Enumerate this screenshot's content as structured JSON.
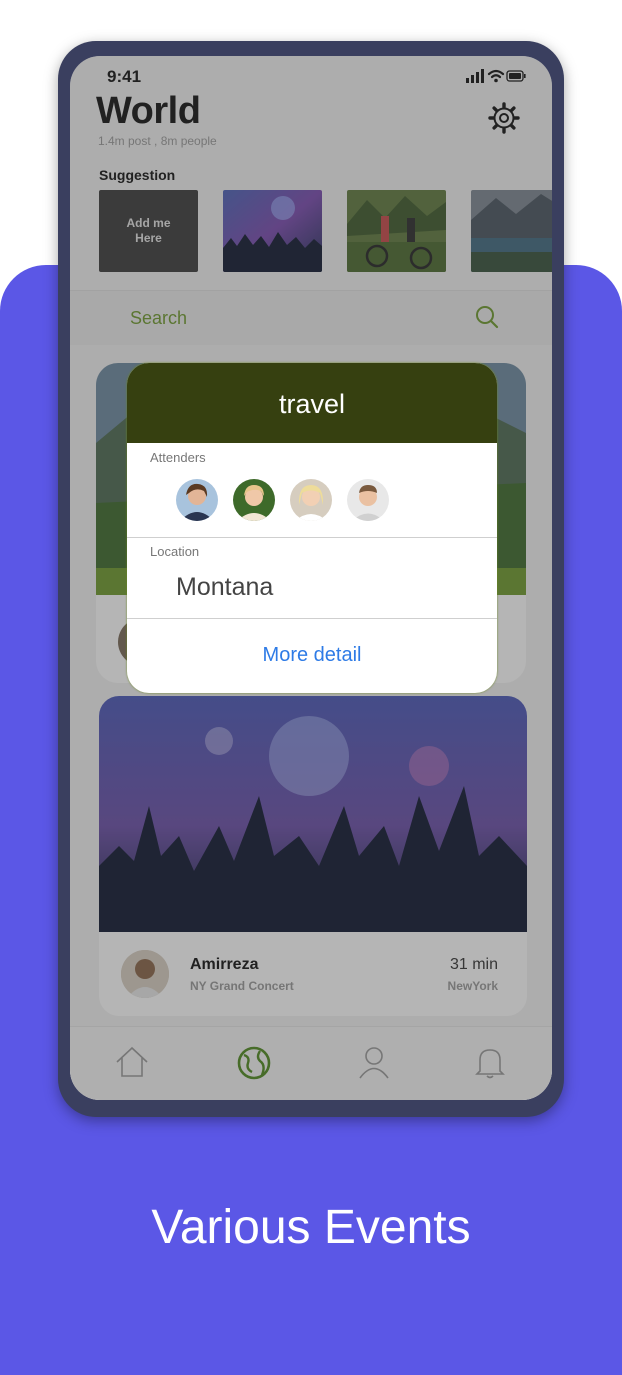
{
  "colors": {
    "background_panel": "#5b57e6",
    "phone_bezel": "#3a3f5f",
    "accent_green": "#6e9a2c",
    "popup_header": "#364010",
    "link_blue": "#2e7be6"
  },
  "status_bar": {
    "time": "9:41",
    "icons": [
      "signal-icon",
      "wifi-icon",
      "battery-icon"
    ]
  },
  "header": {
    "title": "World",
    "subtitle": "1.4m post , 8m people",
    "settings_icon": "gear-icon"
  },
  "suggestion": {
    "label": "Suggestion",
    "items": [
      {
        "label": "Add me\nHere"
      },
      {
        "label": "",
        "image": "concert-crowd"
      },
      {
        "label": "",
        "image": "mountain-bikers"
      },
      {
        "label": "",
        "image": "mountain-lake"
      }
    ]
  },
  "search": {
    "placeholder": "Search",
    "icon": "search-icon"
  },
  "feed": [
    {
      "image": "mountain-landscape"
    },
    {
      "image": "concert-crowd",
      "author": "Amirreza",
      "event": "NY Grand Concert",
      "time": "31 min",
      "location": "NewYork"
    }
  ],
  "popup": {
    "title": "travel",
    "attenders_label": "Attenders",
    "attenders": [
      "attender-1",
      "attender-2",
      "attender-3",
      "attender-4"
    ],
    "location_label": "Location",
    "location": "Montana",
    "action": "More detail"
  },
  "tabbar": {
    "tabs": [
      "home-icon",
      "globe-icon",
      "profile-icon",
      "bell-icon"
    ],
    "active": "globe-icon"
  },
  "footer": {
    "caption": "Various Events"
  }
}
